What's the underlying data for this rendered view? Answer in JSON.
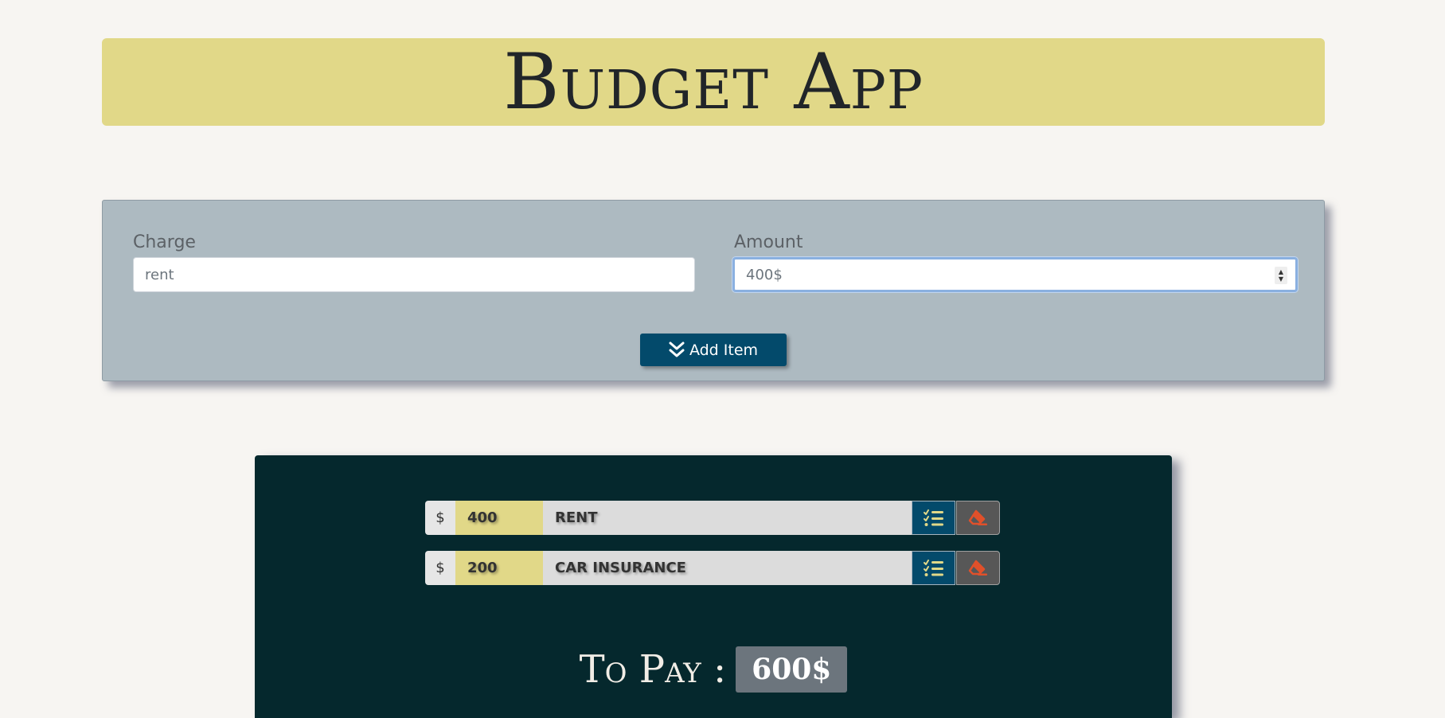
{
  "header": {
    "title": "Budget App"
  },
  "form": {
    "charge_label": "Charge",
    "charge_value": "rent",
    "amount_label": "Amount",
    "amount_value": "400$",
    "add_button_label": "Add Item"
  },
  "items": [
    {
      "currency": "$",
      "amount": "400",
      "charge": "RENT"
    },
    {
      "currency": "$",
      "amount": "200",
      "charge": "CAR INSURANCE"
    }
  ],
  "total": {
    "label": "To Pay :",
    "value": "600$"
  },
  "colors": {
    "header_bg": "#e1d888",
    "form_bg": "#adbac1",
    "primary": "#034a6b",
    "list_bg": "#05282d",
    "delete_icon": "#e0502a",
    "edit_icon": "#e1d888"
  },
  "icons": {
    "add_button": "double-chevron-down-icon",
    "edit": "list-check-icon",
    "delete": "eraser-icon"
  }
}
